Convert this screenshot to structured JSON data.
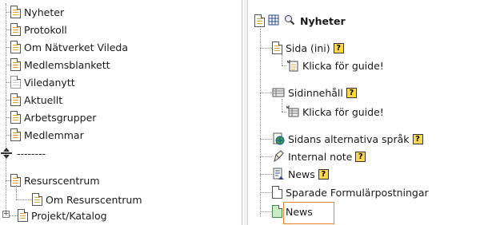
{
  "left_tree": {
    "items": [
      {
        "label": "Nyheter",
        "icon": "page-icon"
      },
      {
        "label": "Protokoll",
        "icon": "page-icon"
      },
      {
        "label": "Om Nätverket Vileda",
        "icon": "page-icon"
      },
      {
        "label": "Medlemsblankett",
        "icon": "page-icon"
      },
      {
        "label": "Viledanytt",
        "icon": "page-gray-icon"
      },
      {
        "label": "Aktuellt",
        "icon": "page-icon"
      },
      {
        "label": "Arbetsgrupper",
        "icon": "page-icon"
      },
      {
        "label": "Medlemmar",
        "icon": "page-icon"
      },
      {
        "label": "--------",
        "icon": "separator-icon"
      },
      {
        "label": "Resurscentrum",
        "icon": "page-icon"
      },
      {
        "label": "Om Resurscentrum",
        "icon": "page-icon"
      },
      {
        "label": "Projekt/Katalog",
        "icon": "page-icon"
      }
    ]
  },
  "right_tree": {
    "header": {
      "label": "Nyheter"
    },
    "items": [
      {
        "label": "Sida (ini)",
        "help": "?"
      },
      {
        "label": "Klicka för guide!"
      },
      {
        "label": "Sidinnehåll",
        "help": "?"
      },
      {
        "label": "Klicka för guide!"
      },
      {
        "label": "Sidans alternativa språk",
        "help": "?"
      },
      {
        "label": "Internal note",
        "help": "?"
      },
      {
        "label": "News",
        "help": "?"
      },
      {
        "label": "Sparade Formulärpostningar"
      },
      {
        "label": "News"
      }
    ]
  },
  "colors": {
    "highlight": "#e8842c",
    "help_badge": "#ffd84a"
  }
}
